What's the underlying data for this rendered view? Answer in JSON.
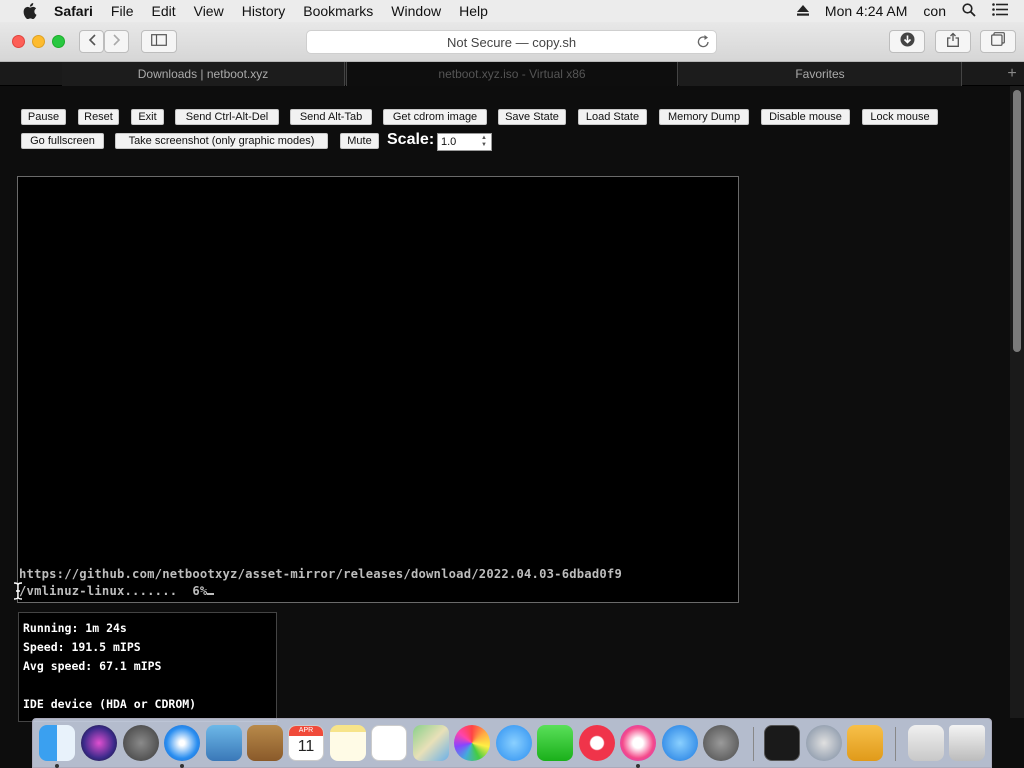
{
  "menubar": {
    "app_name": "Safari",
    "items": [
      "File",
      "Edit",
      "View",
      "History",
      "Bookmarks",
      "Window",
      "Help"
    ],
    "clock": "Mon 4:24 AM",
    "user": "con"
  },
  "toolbar": {
    "address": "Not Secure — copy.sh"
  },
  "tabs": [
    {
      "label": "Downloads | netboot.xyz"
    },
    {
      "label": "netboot.xyz.iso - Virtual x86"
    },
    {
      "label": "Favorites"
    }
  ],
  "controls": {
    "row1": [
      "Pause",
      "Reset",
      "Exit",
      "Send Ctrl-Alt-Del",
      "Send Alt-Tab",
      "Get cdrom image",
      "Save State",
      "Load State",
      "Memory Dump",
      "Disable mouse",
      "Lock mouse"
    ],
    "row2": [
      "Go fullscreen",
      "Take screenshot (only graphic modes)",
      "Mute"
    ],
    "scale_label": "Scale:",
    "scale_value": "1.0"
  },
  "screen": {
    "line1": "https://github.com/netbootxyz/asset-mirror/releases/download/2022.04.03-6dbad0f9",
    "line2": "/vmlinuz-linux.......  6%"
  },
  "stats": {
    "running": "Running: 1m 24s",
    "speed": "Speed: 191.5 mIPS",
    "avg_speed": "Avg speed: 67.1 mIPS",
    "ide": "IDE device (HDA or CDROM)"
  },
  "dock": {
    "calendar_month": "APR",
    "calendar_day": "11"
  },
  "colors": {
    "page_bg": "#0d0d0d",
    "screen_bg": "#000000",
    "terminal_text": "#bdbdbd"
  }
}
